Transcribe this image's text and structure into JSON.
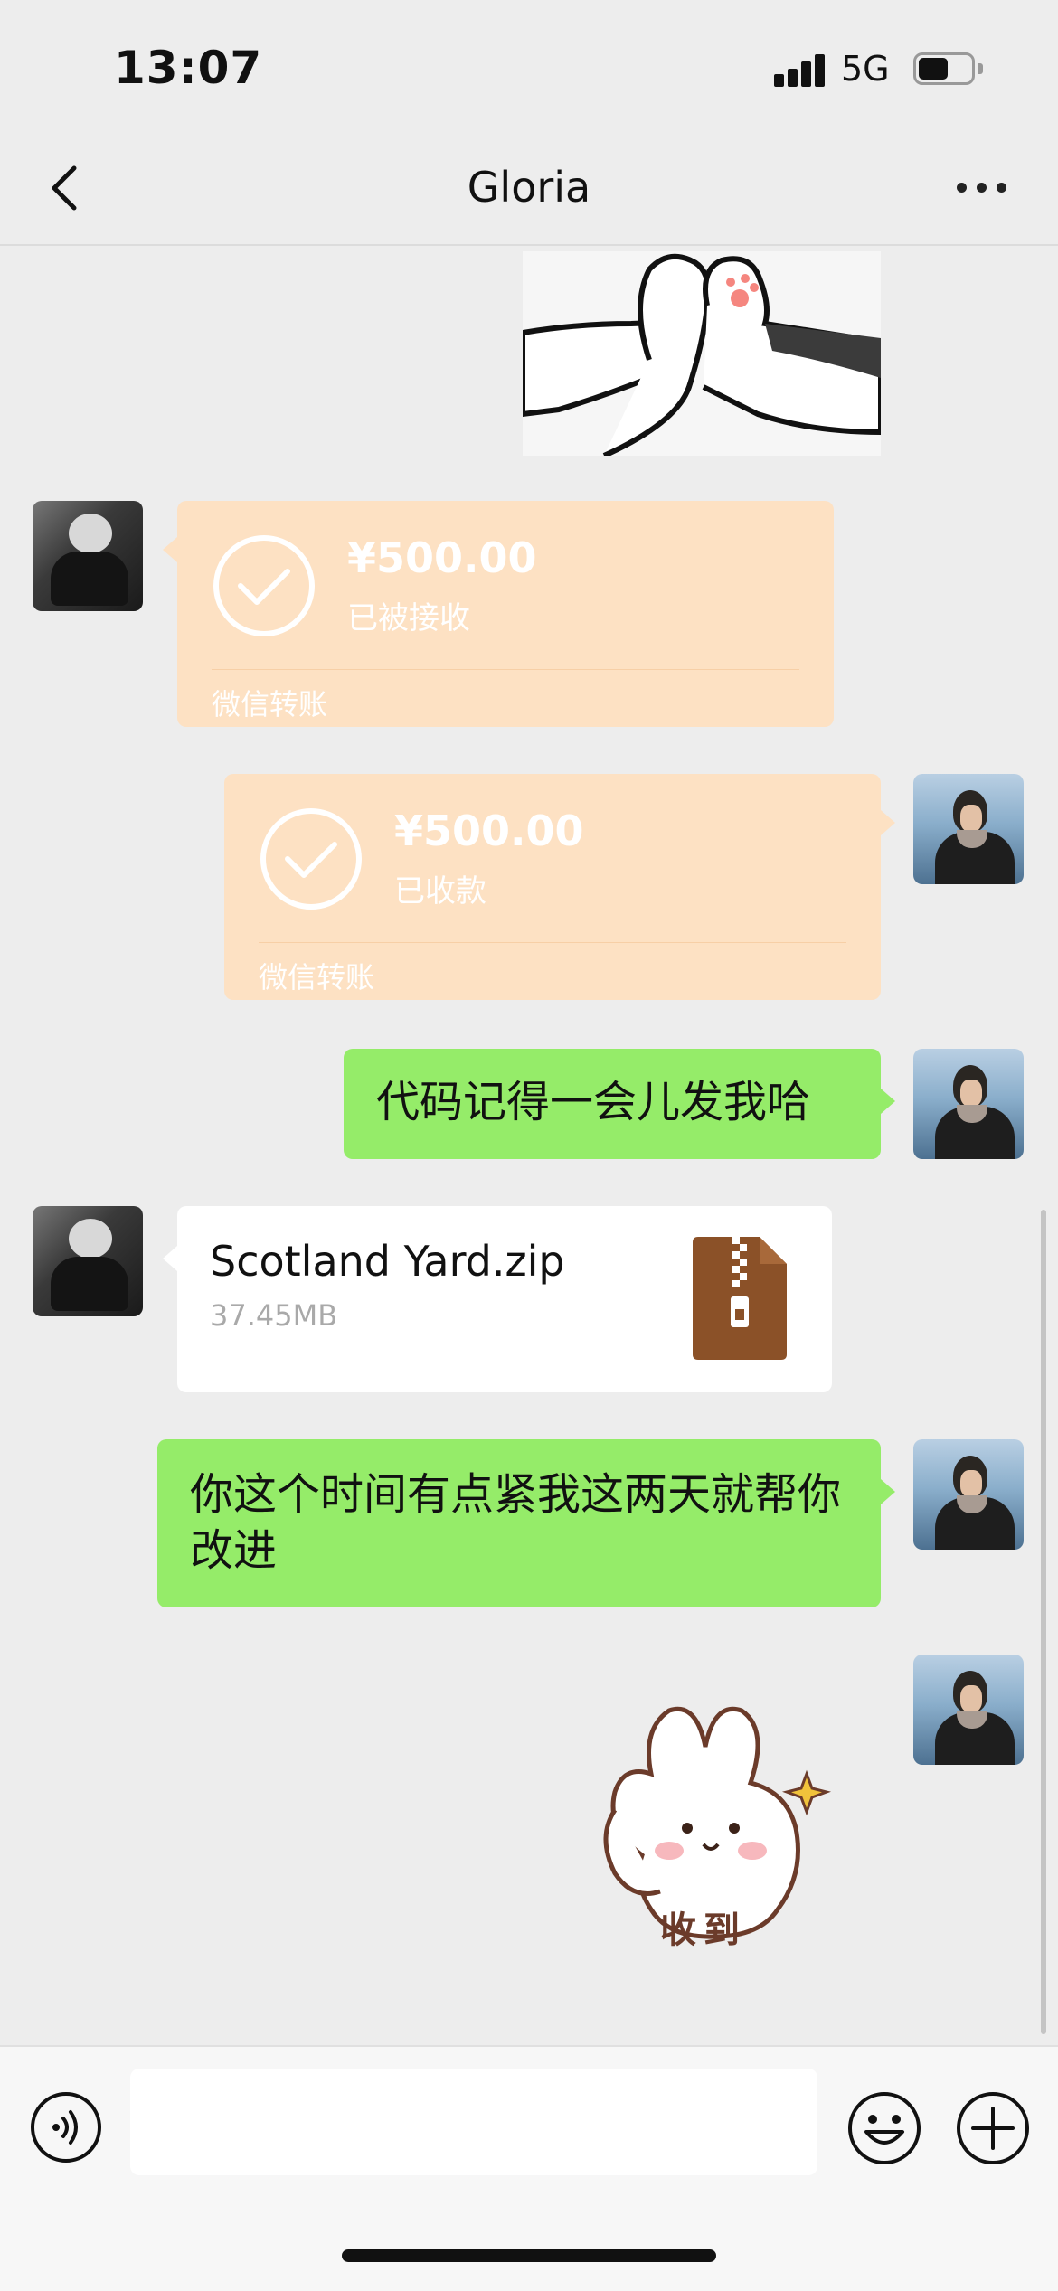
{
  "status_bar": {
    "time": "13:07",
    "network": "5G"
  },
  "nav": {
    "title": "Gloria"
  },
  "messages": {
    "transfer_received": {
      "amount": "¥500.00",
      "status": "已被接收",
      "label": "微信转账"
    },
    "transfer_sent": {
      "amount": "¥500.00",
      "status": "已收款",
      "label": "微信转账"
    },
    "text_1": "代码记得一会儿发我哈",
    "file": {
      "name": "Scotland Yard.zip",
      "size": "37.45MB"
    },
    "text_2": "你这个时间有点紧我这两天就帮你改进",
    "sticker_text": "收到"
  },
  "input": {
    "placeholder": ""
  },
  "colors": {
    "bubble_green": "#95ec69",
    "transfer_orange": "#fde1c3",
    "background": "#ededed"
  }
}
